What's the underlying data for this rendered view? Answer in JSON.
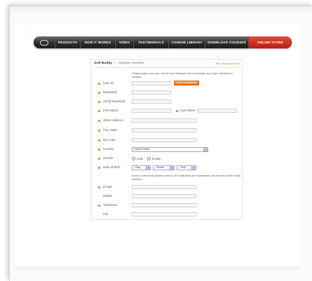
{
  "nav": {
    "items": [
      "PRODUCTS",
      "HOW IT WORKS",
      "VIDEO",
      "TESTIMONIALS",
      "COURSE LIBRARY",
      "DOWNLOAD COURSES",
      "ONLINE STORE"
    ],
    "active": "ONLINE STORE"
  },
  "header": {
    "title": "Golf Buddy",
    "separator": "|",
    "subtitle": "Register Member",
    "required_note": "■ : Obligatory Item"
  },
  "form": {
    "userid_note": "Please make sure your User ID and Password do not contain any Caps, Symbols or Spaces.",
    "email_note": "Enter a valid email address below. All notification and newsletters will be sent to this Email Address.",
    "check_button": "Check Availability",
    "labels": {
      "user_id": "User ID",
      "password": "Password",
      "verify_password": "Verify Password",
      "first_name": "First Name",
      "last_name": "Last Name",
      "street": "Street Address",
      "city_state": "City, State",
      "zip": "Zip Code",
      "country": "Country",
      "gender": "Gender",
      "dob": "Date of Birth",
      "email": "E-mail",
      "mobile": "Mobile",
      "telephone": "Telephone",
      "fax": "Fax"
    },
    "country_value": "United States",
    "gender_options": [
      "male",
      "female"
    ],
    "dob": {
      "day": "- Day -",
      "month": "- Month -",
      "year": "- Year -"
    }
  },
  "colors": {
    "accent": "#e87722",
    "nav_active": "#c9261c",
    "nav_bg": "#2c2c2c"
  }
}
